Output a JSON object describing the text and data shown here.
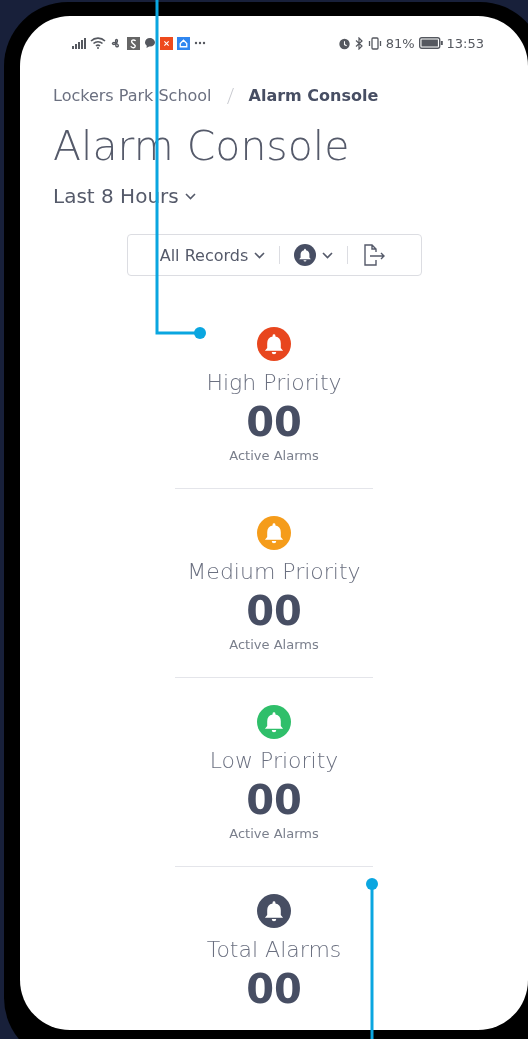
{
  "status_bar": {
    "battery": "81%",
    "time": "13:53"
  },
  "breadcrumb": [
    {
      "label": "Lockers Park School",
      "current": false
    },
    {
      "label": "Alarm Console",
      "current": true
    }
  ],
  "title": "Alarm Console",
  "time_range": "Last 8 Hours",
  "toolbar": {
    "filter": "All Records"
  },
  "summaries": [
    {
      "label": "High Priority",
      "count": "00",
      "caption": "Active Alarms",
      "color": "#e8461e"
    },
    {
      "label": "Medium Priority",
      "count": "00",
      "caption": "Active Alarms",
      "color": "#f59c1a"
    },
    {
      "label": "Low Priority",
      "count": "00",
      "caption": "Active Alarms",
      "color": "#2fbf6a"
    },
    {
      "label": "Total Alarms",
      "count": "00",
      "color": "#474e63"
    }
  ]
}
